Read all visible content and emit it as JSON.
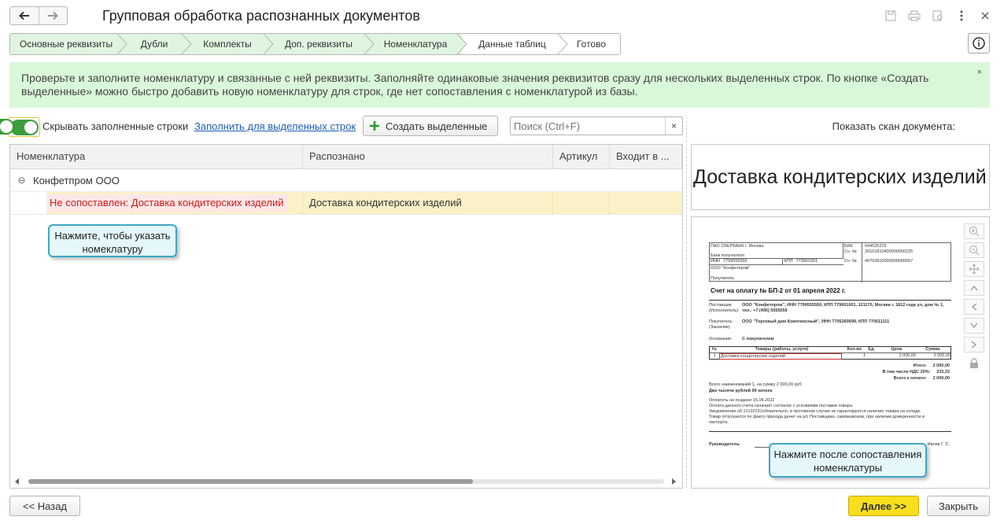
{
  "window": {
    "title": "Групповая обработка распознанных документов",
    "back_icon": "arrow-left-icon",
    "forward_icon": "arrow-right-icon"
  },
  "steps": [
    {
      "label": "Основные реквизиты",
      "done": true
    },
    {
      "label": "Дубли",
      "done": true
    },
    {
      "label": "Комплекты",
      "done": true
    },
    {
      "label": "Доп. реквизиты",
      "done": true
    },
    {
      "label": "Номенклатура",
      "done": true
    },
    {
      "label": "Данные таблиц",
      "done": false
    },
    {
      "label": "Готово",
      "done": false
    }
  ],
  "banner": {
    "text": "Проверьте и заполните номенклатуру и связанные с ней реквизиты. Заполняйте одинаковые значения реквизитов сразу для нескольких выделенных строк. По кнопке «Создать выделенные» можно быстро добавить новую номенклатуру для строк, где нет сопоставления с номенклатурой из базы.",
    "close": "×"
  },
  "toolbar": {
    "hide_filled_label": "Скрывать заполненные строки",
    "fill_selected_link": "Заполнить для выделенных строк",
    "create_selected_label": "Создать выделенные",
    "search_placeholder": "Поиск (Ctrl+F)",
    "search_clear": "×",
    "show_scan_label": "Показать скан документа:"
  },
  "table": {
    "columns": [
      "Номенклатура",
      "Распознано",
      "Артикул",
      "Входит в ..."
    ],
    "group": {
      "expander": "⊖",
      "label": "Конфетпром ООО"
    },
    "rows": [
      {
        "nomenclature": "Не сопоставлен: Доставка кондитерских изделий",
        "recognized": "Доставка кондитерских изделий",
        "article": "",
        "includes": ""
      }
    ]
  },
  "callouts": {
    "nomenclature_hint": "Нажмите, чтобы указать номеклатуру",
    "next_hint": "Нажмите после сопоставления номенклатуры"
  },
  "preview": {
    "text": "Доставка кондитерских изделий"
  },
  "document": {
    "bank": "ПАО СБЕРБАНК г. Москва",
    "bank_label": "Банк получателя",
    "bik_label": "БИК",
    "bik": "044525225",
    "acc_label": "Сч. №",
    "corr_acc": "30101810400000000225",
    "inn_label": "ИНН",
    "inn": "7799555550",
    "kpp_label": "КПП",
    "kpp": "779901001",
    "acc": "40702810000000000007",
    "recipient": "ООО \"Конфетпром\"",
    "recipient_label": "Получатель",
    "invoice_title": "Счет на оплату № БП-2 от 01 апреля 2022 г.",
    "supplier_label": "Поставщик: (Исполнитель):",
    "supplier": "ООО \"Конфетпром\", ИНН 7799555550, КПП 779901001, 121170, Москва г, 1812 года ул, дом № 1, тел.: +7 (495) 5555555",
    "buyer_label": "Покупатель (Заказчик):",
    "buyer": "ООО \"Торговый дом Комплексный\", ИНН 7705260699, КПП 770511111",
    "basis_label": "Основание:",
    "basis": "С покупателем",
    "item_headers": [
      "№",
      "Товары (работы, услуги)",
      "Кол-во",
      "Ед.",
      "Цена",
      "Сумма"
    ],
    "item": [
      "1",
      "Доставка кондитерских изделий",
      "1",
      "",
      "2 000,00",
      "2 000,00"
    ],
    "total_label": "Итого:",
    "total": "2 000,00",
    "vat_label": "В том числе НДС 20%:",
    "vat": "333,33",
    "due_label": "Всего к оплате:",
    "due": "2 000,00",
    "summary": "Всего наименований 1, на сумму 2 000,00 руб",
    "summary_words": "Две тысячи рублей 00 копеек",
    "note1": "Оплатить не позднее 15.04.2022",
    "note2": "Оплата данного счета означает согласие с условиями поставки товара.",
    "note3": "Уведомление об 21132231обязательно, в противном случае не гарантируется наличие товара на складе.",
    "note4": "Товар отпускается по факту прихода денег на р/с Поставщика, самовывозом, при наличии доверенности и паспорта.",
    "signer_label": "Руководитель",
    "signer": "Ивлев Г. С."
  },
  "buttons": {
    "back": "<< Назад",
    "next": "Далее >>",
    "close": "Закрыть"
  }
}
